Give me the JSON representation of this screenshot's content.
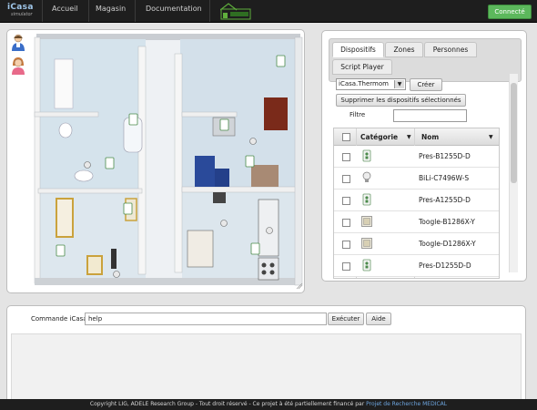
{
  "app": {
    "logo_line1": "iCasa",
    "logo_line2": "simulator",
    "nav": [
      "Accueil",
      "Magasin",
      "Documentation"
    ],
    "connect_label": "Connecté",
    "accent_color": "#5cb85c"
  },
  "map": {
    "person_icons": [
      "man-avatar-icon",
      "woman-avatar-icon"
    ]
  },
  "devices_panel": {
    "tabs": [
      "Dispositifs",
      "Zones",
      "Personnes",
      "Script Player"
    ],
    "active_tab": "Dispositifs",
    "device_type_value": "iCasa.Thermom",
    "create_label": "Créer",
    "delete_selected_label": "Supprimer les dispositifs sélectionnés",
    "filter_label": "Filtre",
    "filter_value": "",
    "columns": [
      "Catégorie",
      "Nom"
    ],
    "rows": [
      {
        "icon": "presence-sensor-icon",
        "name": "Pres-B1255D-D"
      },
      {
        "icon": "light-bulb-icon",
        "name": "BiLi-C7496W-S"
      },
      {
        "icon": "presence-sensor-icon",
        "name": "Pres-A1255D-D"
      },
      {
        "icon": "toggle-switch-icon",
        "name": "Toogle-B1286X-Y"
      },
      {
        "icon": "toggle-switch-icon",
        "name": "Toogle-D1286X-Y"
      },
      {
        "icon": "presence-sensor-icon",
        "name": "Pres-D1255D-D"
      }
    ]
  },
  "command": {
    "label": "Commande iCasa :",
    "value": "help",
    "execute_label": "Exécuter",
    "help_label": "Aide"
  },
  "footer": {
    "text": "Copyright LIG, ADELE Research Group - Tout droit réservé - Ce projet à été partiellement financé par",
    "link": "Projet de Recherche MEDICAL"
  }
}
